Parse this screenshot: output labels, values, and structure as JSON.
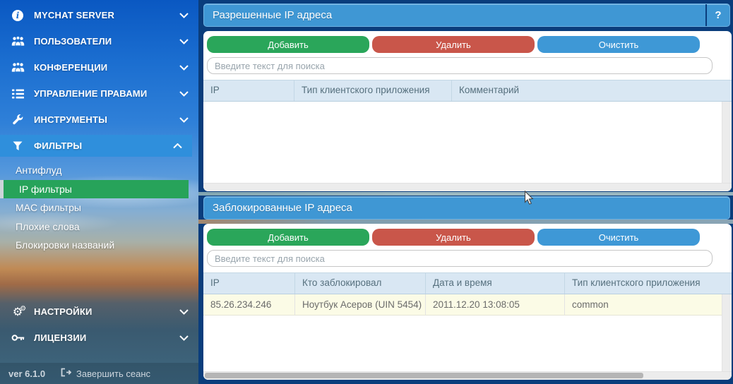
{
  "sidebar": {
    "menu": [
      {
        "label": "MYCHAT SERVER",
        "icon": "info-icon"
      },
      {
        "label": "ПОЛЬЗОВАТЕЛИ",
        "icon": "users-icon"
      },
      {
        "label": "КОНФЕРЕНЦИИ",
        "icon": "users-icon"
      },
      {
        "label": "УПРАВЛЕНИЕ ПРАВАМИ",
        "icon": "list-icon"
      },
      {
        "label": "ИНСТРУМЕНТЫ",
        "icon": "wrench-icon"
      },
      {
        "label": "ФИЛЬТРЫ",
        "icon": "filter-icon",
        "expanded": true
      }
    ],
    "submenu": [
      "Антифлуд",
      "IP фильтры",
      "MAC фильтры",
      "Плохие слова",
      "Блокировки названий"
    ],
    "selected_submenu": "IP фильтры",
    "menu_bottom": [
      {
        "label": "НАСТРОЙКИ",
        "icon": "gears-icon"
      },
      {
        "label": "ЛИЦЕНЗИИ",
        "icon": "key-icon"
      }
    ],
    "version": "ver 6.1.0",
    "logout_label": "Завершить сеанс"
  },
  "allowed_panel": {
    "title": "Разрешенные IP адреса",
    "help_label": "?",
    "buttons": {
      "add": "Добавить",
      "delete": "Удалить",
      "clear": "Очистить"
    },
    "search_placeholder": "Введите текст для поиска",
    "table": {
      "columns": [
        "IP",
        "Тип клиентского приложения",
        "Комментарий"
      ],
      "rows": []
    }
  },
  "blocked_panel": {
    "title": "Заблокированные IP адреса",
    "buttons": {
      "add": "Добавить",
      "delete": "Удалить",
      "clear": "Очистить"
    },
    "search_placeholder": "Введите текст для поиска",
    "table": {
      "columns": [
        "IP",
        "Кто заблокировал",
        "Дата и время",
        "Тип клиентского приложения"
      ],
      "rows": [
        [
          "85.26.234.246",
          "Ноутбук Асеров (UIN 5454)",
          "2011.12.20 13:08:05",
          "common"
        ]
      ]
    }
  },
  "colors": {
    "accent_navy": "#0a3d7c",
    "panel_header_blue": "#3f97d4",
    "button_green": "#2aa65a",
    "button_red": "#c9564a",
    "button_blue": "#3e98d6",
    "sidebar_highlight_blue": "#2f8fdc",
    "selected_green": "#27a35a",
    "row_highlight_yellow": "#fbfbe6",
    "table_header_bg": "#d9e7f3"
  }
}
